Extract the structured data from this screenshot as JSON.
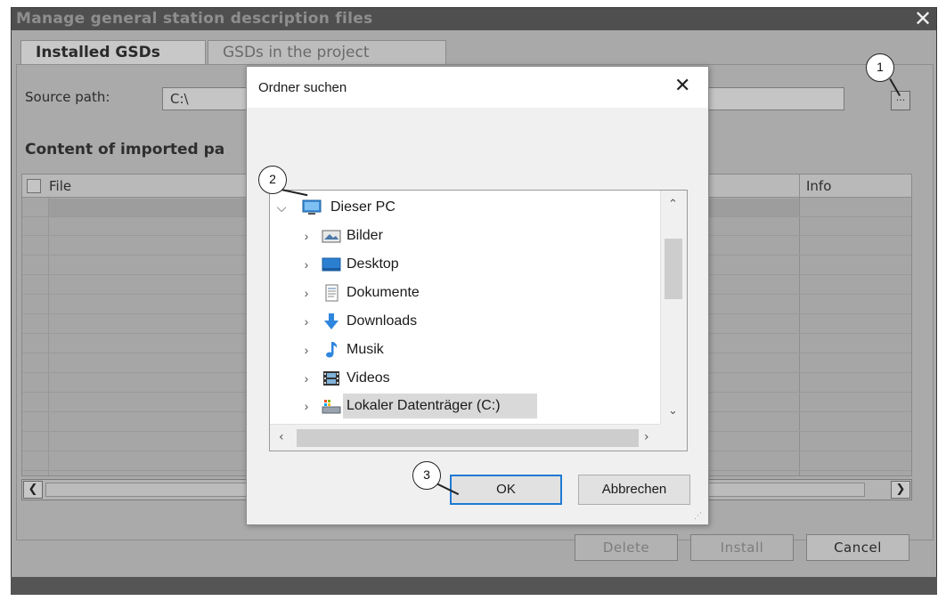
{
  "window": {
    "title": "Manage general station description files",
    "close_glyph": "✕"
  },
  "tabs": [
    {
      "label": "Installed GSDs",
      "active": true
    },
    {
      "label": "GSDs in the project",
      "active": false
    }
  ],
  "source": {
    "label": "Source path:",
    "value": "C:\\",
    "browse_label": "..."
  },
  "content": {
    "heading": "Content of imported pa",
    "columns": {
      "file": "File",
      "info": "Info"
    }
  },
  "buttons": {
    "delete": "Delete",
    "install": "Install",
    "cancel": "Cancel"
  },
  "callouts": [
    "1",
    "2",
    "3"
  ],
  "folder_dialog": {
    "title": "Ordner suchen",
    "close_glyph": "✕",
    "tree": [
      {
        "label": "Dieser PC",
        "icon": "computer-icon",
        "expanded": true,
        "level": 0
      },
      {
        "label": "Bilder",
        "icon": "pictures-folder-icon",
        "level": 1
      },
      {
        "label": "Desktop",
        "icon": "desktop-folder-icon",
        "level": 1
      },
      {
        "label": "Dokumente",
        "icon": "documents-folder-icon",
        "level": 1
      },
      {
        "label": "Downloads",
        "icon": "downloads-arrow-icon",
        "level": 1
      },
      {
        "label": "Musik",
        "icon": "music-note-icon",
        "level": 1
      },
      {
        "label": "Videos",
        "icon": "video-film-icon",
        "level": 1
      },
      {
        "label": "Lokaler Datenträger (C:)",
        "icon": "local-drive-icon",
        "level": 1,
        "selected": true
      }
    ],
    "ok_label": "OK",
    "cancel_label": "Abbrechen"
  },
  "colors": {
    "dialog_titlebar": "#4f4f4f",
    "dimmed_background": "#aaaaaa",
    "ok_focus_border": "#1f7ad4",
    "selection": "#d9d9d9"
  }
}
